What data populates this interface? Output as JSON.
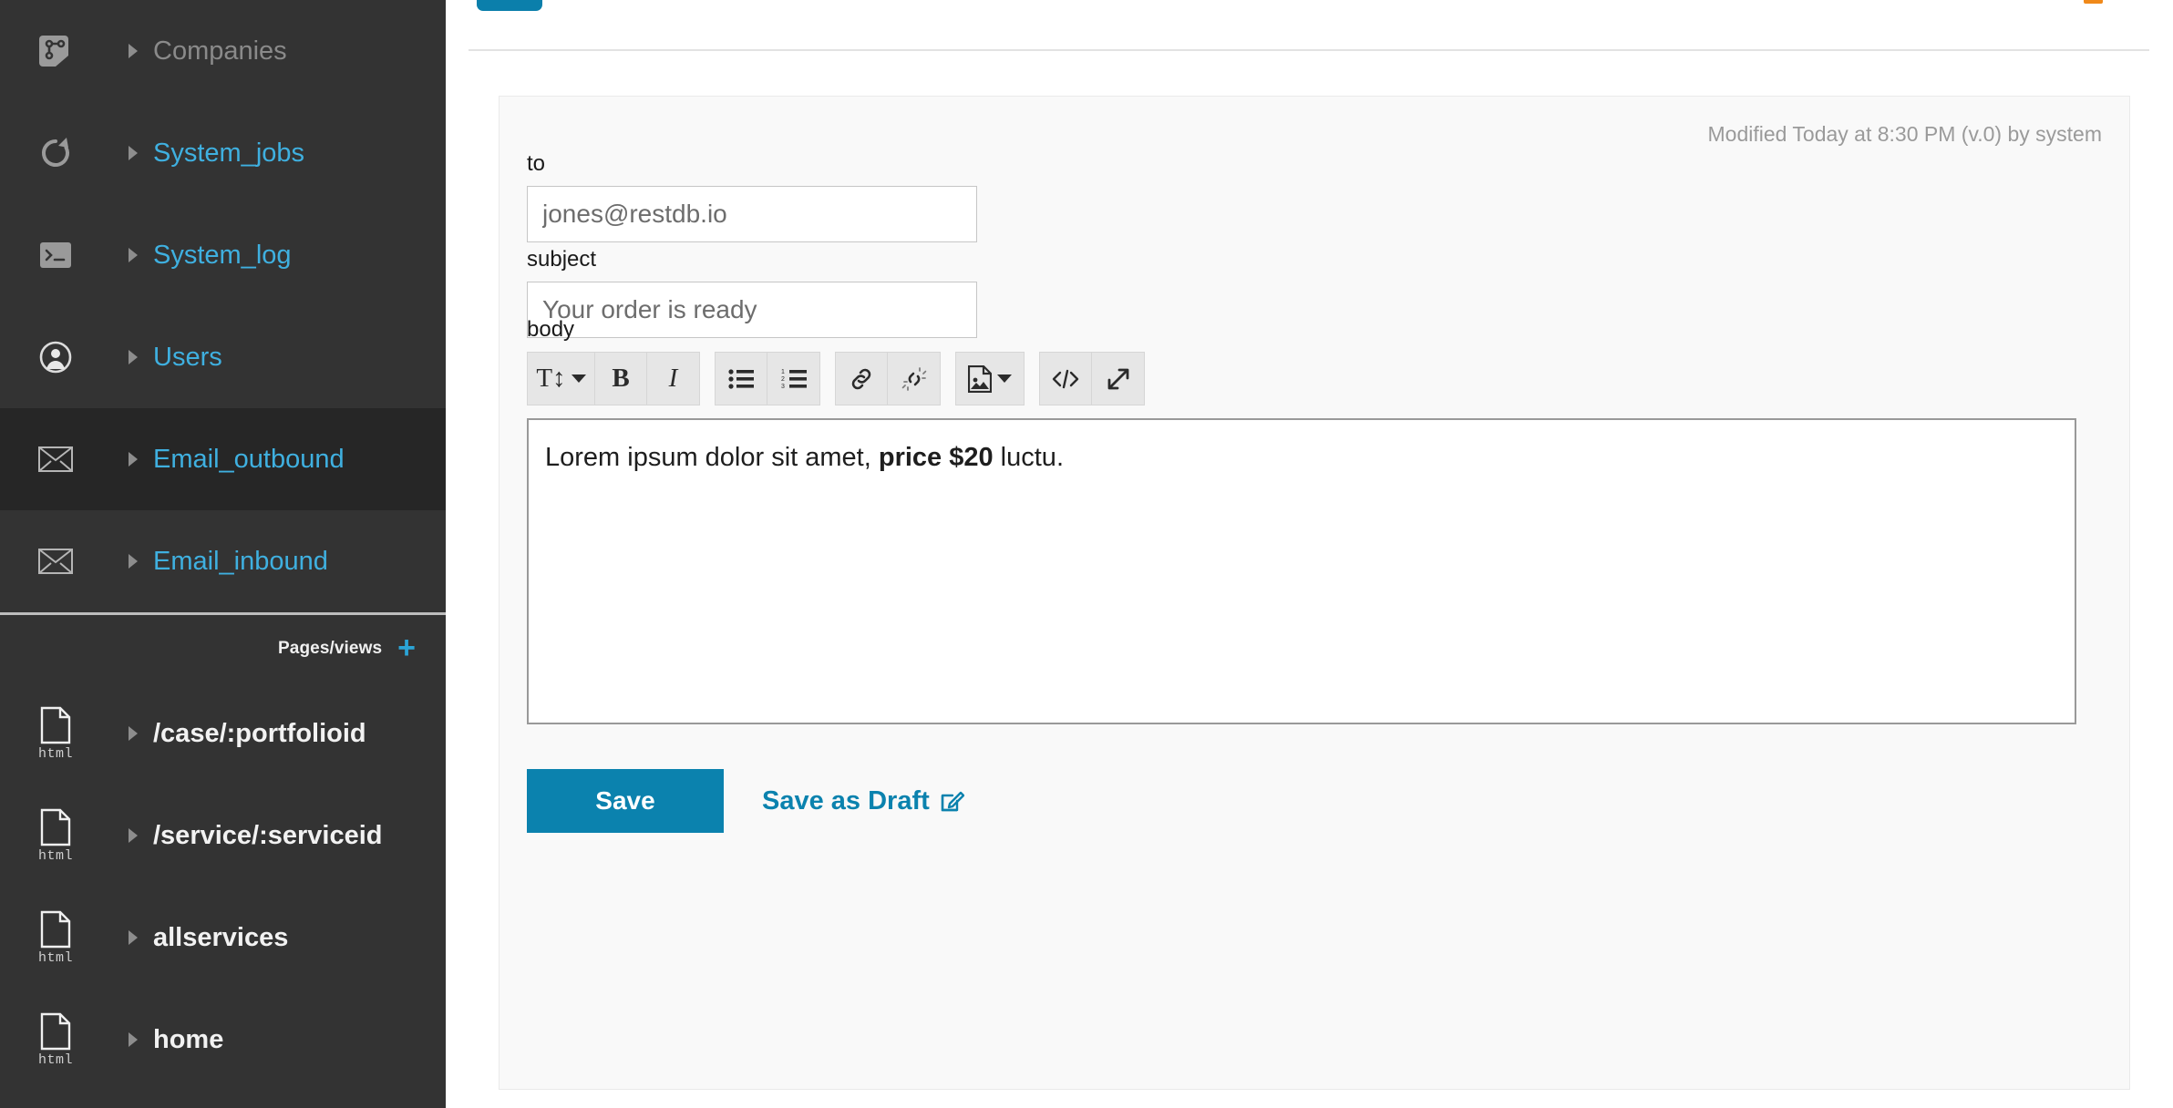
{
  "sidebar": {
    "collections": [
      {
        "label": "Companies",
        "icon": "database-collection-icon",
        "style": "gray",
        "caret": "chevron-right-icon"
      },
      {
        "label": "System_jobs",
        "icon": "refresh-icon",
        "style": "blue",
        "caret": "chevron-right-icon"
      },
      {
        "label": "System_log",
        "icon": "terminal-icon",
        "style": "blue",
        "caret": "chevron-right-icon"
      },
      {
        "label": "Users",
        "icon": "user-circle-icon",
        "style": "blue",
        "caret": "chevron-right-icon"
      },
      {
        "label": "Email_outbound",
        "icon": "envelope-icon",
        "style": "blue",
        "caret": "chevron-right-icon",
        "active": true
      },
      {
        "label": "Email_inbound",
        "icon": "envelope-icon",
        "style": "blue",
        "caret": "chevron-right-icon"
      }
    ],
    "pages_section": {
      "label": "Pages/views",
      "add_label": "+"
    },
    "pages": [
      {
        "label": "/case/:portfolioid",
        "icon": "html-file-icon",
        "ext": "html",
        "caret": "chevron-right-icon"
      },
      {
        "label": "/service/:serviceid",
        "icon": "html-file-icon",
        "ext": "html",
        "caret": "chevron-right-icon"
      },
      {
        "label": "allservices",
        "icon": "html-file-icon",
        "ext": "html",
        "caret": "chevron-right-icon"
      },
      {
        "label": "home",
        "icon": "html-file-icon",
        "ext": "html",
        "caret": "chevron-right-icon"
      }
    ]
  },
  "record": {
    "modified_info": "Modified Today at 8:30 PM (v.0) by system",
    "fields": {
      "to": {
        "label": "to",
        "value": "jones@restdb.io",
        "placeholder": "to"
      },
      "subject": {
        "label": "subject",
        "value": "Your order is ready",
        "placeholder": "subject"
      },
      "body": {
        "label": "body",
        "text_before": "Lorem ipsum dolor sit amet, ",
        "text_bold": "price $20",
        "text_after": " luctu."
      }
    }
  },
  "editor_toolbar": {
    "groups": [
      [
        {
          "name": "font-size-button",
          "glyph": "T↕",
          "caret": true
        },
        {
          "name": "bold-button",
          "glyph": "B"
        },
        {
          "name": "italic-button",
          "glyph": "I"
        }
      ],
      [
        {
          "name": "unordered-list-button",
          "glyph": "bullet-list-icon"
        },
        {
          "name": "ordered-list-button",
          "glyph": "numbered-list-icon"
        }
      ],
      [
        {
          "name": "insert-link-button",
          "glyph": "link-icon"
        },
        {
          "name": "unlink-button",
          "glyph": "unlink-icon"
        }
      ],
      [
        {
          "name": "insert-image-button",
          "glyph": "image-icon",
          "caret": true
        }
      ],
      [
        {
          "name": "code-view-button",
          "glyph": "code-icon"
        },
        {
          "name": "fullscreen-button",
          "glyph": "expand-icon"
        }
      ]
    ]
  },
  "actions": {
    "save_label": "Save",
    "save_draft_label": "Save as Draft",
    "save_draft_icon": "pencil-square-icon"
  },
  "colors": {
    "sidebar_bg": "#333333",
    "sidebar_active_bg": "#262626",
    "link_blue": "#3fb0e0",
    "accent_blue": "#0b82ae",
    "plus_blue": "#2ba4d6",
    "orange": "#f0891a"
  }
}
